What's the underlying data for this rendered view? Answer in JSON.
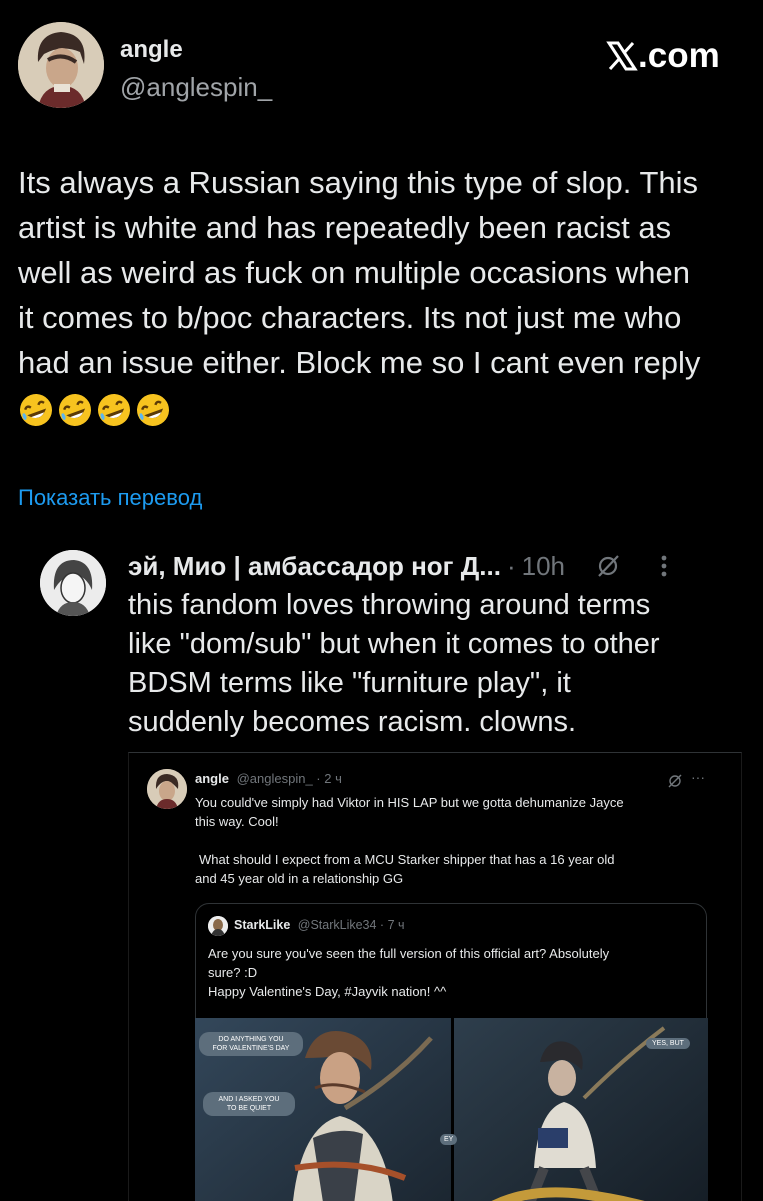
{
  "post": {
    "display_name": "angle",
    "handle": "@anglespin_",
    "brand": "X.com",
    "text_lines": [
      "Its always a Russian saying this type of slop. This",
      "artist is white and has repeatedly been racist as",
      "well as weird as fuck on multiple occasions when",
      "it comes to b/poc characters. Its not just me who",
      "had an issue either. Block me so I cant even reply"
    ],
    "emoji_count": 4,
    "emoji_name": "rolling-on-floor-laughing",
    "translate_link": "Показать перевод"
  },
  "quoted": {
    "display_name": "эй, Мио | амбассадор ног Д...",
    "separator": "·",
    "time": "10h",
    "text_lines": [
      "this fandom loves throwing around terms",
      "like \"dom/sub\" but when it comes to other",
      "BDSM terms like \"furniture play\", it",
      "suddenly becomes racism. clowns."
    ]
  },
  "screenshot": {
    "display_name": "angle",
    "handle_time": "@anglespin_ · 2 ч",
    "text_lines": [
      "You could've simply had Viktor in HIS LAP but we gotta dehumanize Jayce",
      "this way. Cool!"
    ],
    "text2_lines": [
      "What should I expect from a MCU Starker shipper that has a 16 year old",
      "and 45 year old in a relationship GG"
    ],
    "inner": {
      "display_name": "StarkLike",
      "handle_time": "@StarkLike34 · 7 ч",
      "text_lines": [
        "Are you sure you've seen the full version of this official art? Absolutely",
        "sure? :D",
        "Happy Valentine's Day, #Jayvik nation! ^^"
      ],
      "bubbles": {
        "b1_line1": "DO ANYTHING YOU",
        "b1_line2": "FOR VALENTINE'S DAY",
        "b2_line1": "AND I ASKED YOU",
        "b2_line2": "TO BE QUIET",
        "b3": "YES, BUT",
        "b4": "EY"
      }
    }
  },
  "colors": {
    "background": "#000000",
    "text": "#e7e9ea",
    "muted": "#71767b",
    "link": "#1d9bf0"
  }
}
